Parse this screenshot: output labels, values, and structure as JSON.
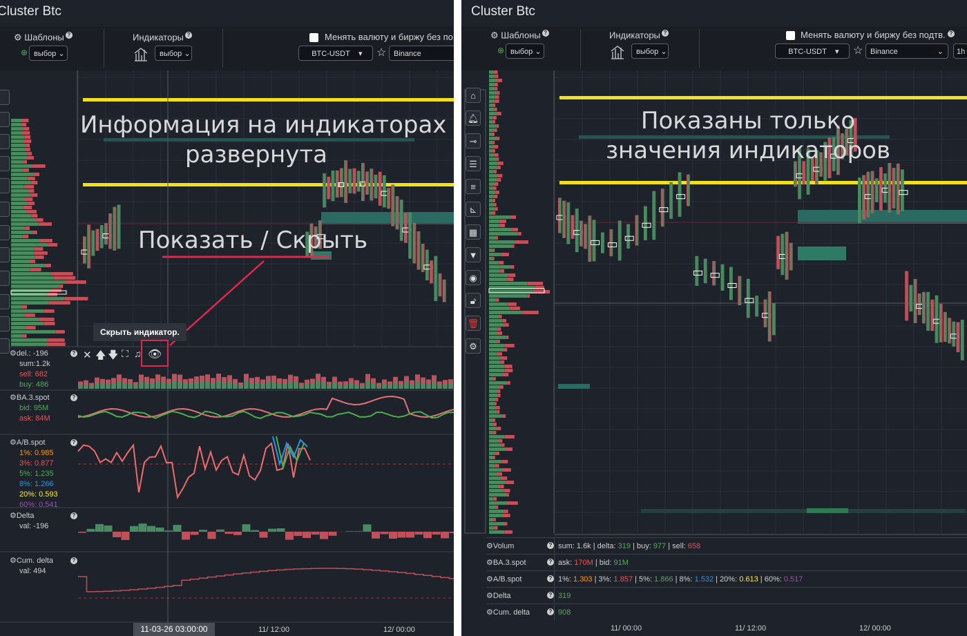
{
  "left": {
    "title": "Cluster Btc",
    "toolbar": {
      "templates_label": "Шаблоны",
      "templates_select": "выбор",
      "indicators_label": "Индикаторы",
      "indicators_select": "выбор",
      "currency_checkbox_label": "Менять валюту и биржу без по",
      "pair": "BTC-USDT",
      "exchange": "Binance"
    },
    "annotation_top": "Информация на индикаторах\nразвернута",
    "annotation_show_hide": "Показать / Скрыть",
    "tooltip": "Скрыть индикатор.",
    "indicators": [
      {
        "name": "del.: -196",
        "lines": [
          {
            "text": "sum:1.2k",
            "color": "#d0d0d0"
          },
          {
            "text": "sell: 682",
            "color": "#ef5350"
          },
          {
            "text": "buy: 486",
            "color": "#4caf50"
          }
        ]
      },
      {
        "name": "BA.3.spot",
        "lines": [
          {
            "text": "bid: 95M",
            "color": "#4caf50"
          },
          {
            "text": "ask: 84M",
            "color": "#ef5350"
          }
        ]
      },
      {
        "name": "A/B.spot",
        "lines": [
          {
            "text": "1%:",
            "value": "0.985",
            "color": "#ff9800"
          },
          {
            "text": "3%:",
            "value": "0.877",
            "color": "#ef5350"
          },
          {
            "text": "5%:",
            "value": "1.235",
            "color": "#4caf50"
          },
          {
            "text": "8%:",
            "value": "1.266",
            "color": "#2196f3"
          },
          {
            "text": "20%:",
            "value": "0.593",
            "color": "#ffeb3b"
          },
          {
            "text": "60%:",
            "value": "0.541",
            "color": "#ab47bc"
          }
        ]
      },
      {
        "name": "Delta",
        "lines": [
          {
            "text": "val:  -196",
            "color": "#d0d0d0"
          }
        ]
      },
      {
        "name": "Cum. delta",
        "lines": [
          {
            "text": "val:  494",
            "color": "#d0d0d0"
          }
        ]
      }
    ],
    "time_labels": [
      "11-03-26 03:00:00",
      "11/ 12:00",
      "12/ 00:00"
    ]
  },
  "right": {
    "title": "Cluster Btc",
    "toolbar": {
      "templates_label": "Шаблоны",
      "templates_select": "выбор",
      "indicators_label": "Индикаторы",
      "indicators_select": "выбор",
      "currency_checkbox_label": "Менять валюту и биржу без подтв.",
      "pair": "BTC-USDT",
      "exchange": "Binance",
      "timeframe": "1h"
    },
    "annotation": "Показаны только\nзначения индикаторов",
    "summary_rows": [
      {
        "name": "Volum",
        "parts": [
          [
            "sum: 1.6k | delta: ",
            "#d0d0d0"
          ],
          [
            "319",
            "#4caf50"
          ],
          [
            " | buy: ",
            "#d0d0d0"
          ],
          [
            "977",
            "#4caf50"
          ],
          [
            " | sell: ",
            "#d0d0d0"
          ],
          [
            "658",
            "#ef5350"
          ]
        ]
      },
      {
        "name": "BA.3.spot",
        "parts": [
          [
            "ask: ",
            "#d0d0d0"
          ],
          [
            "170M",
            "#ef5350"
          ],
          [
            " | bid: ",
            "#d0d0d0"
          ],
          [
            "91M",
            "#4caf50"
          ]
        ]
      },
      {
        "name": "A/B.spot",
        "parts": [
          [
            "1%: ",
            "#d0d0d0"
          ],
          [
            "1.303",
            "#ff9800"
          ],
          [
            " | 3%: ",
            "#d0d0d0"
          ],
          [
            "1.857",
            "#ef5350"
          ],
          [
            " | 5%: ",
            "#d0d0d0"
          ],
          [
            "1.866",
            "#4caf50"
          ],
          [
            " | 8%: ",
            "#d0d0d0"
          ],
          [
            "1.532",
            "#2196f3"
          ],
          [
            " | 20%: ",
            "#d0d0d0"
          ],
          [
            "0.613",
            "#ffeb3b"
          ],
          [
            " | 60%: ",
            "#d0d0d0"
          ],
          [
            "0.517",
            "#ab47bc"
          ]
        ]
      },
      {
        "name": "Delta",
        "parts": [
          [
            "319",
            "#4caf50"
          ]
        ]
      },
      {
        "name": "Cum. delta",
        "parts": [
          [
            "908",
            "#4caf50"
          ]
        ]
      }
    ],
    "time_labels": [
      "11/ 00:00",
      "11/ 12:00",
      "12/ 00:00"
    ]
  },
  "colors": {
    "bg": "#1e222b",
    "toolbar": "#1a1d24",
    "green": "#4a8a60",
    "red": "#c0505a",
    "yellow": "#f0e020",
    "accent": "#e0284f"
  }
}
